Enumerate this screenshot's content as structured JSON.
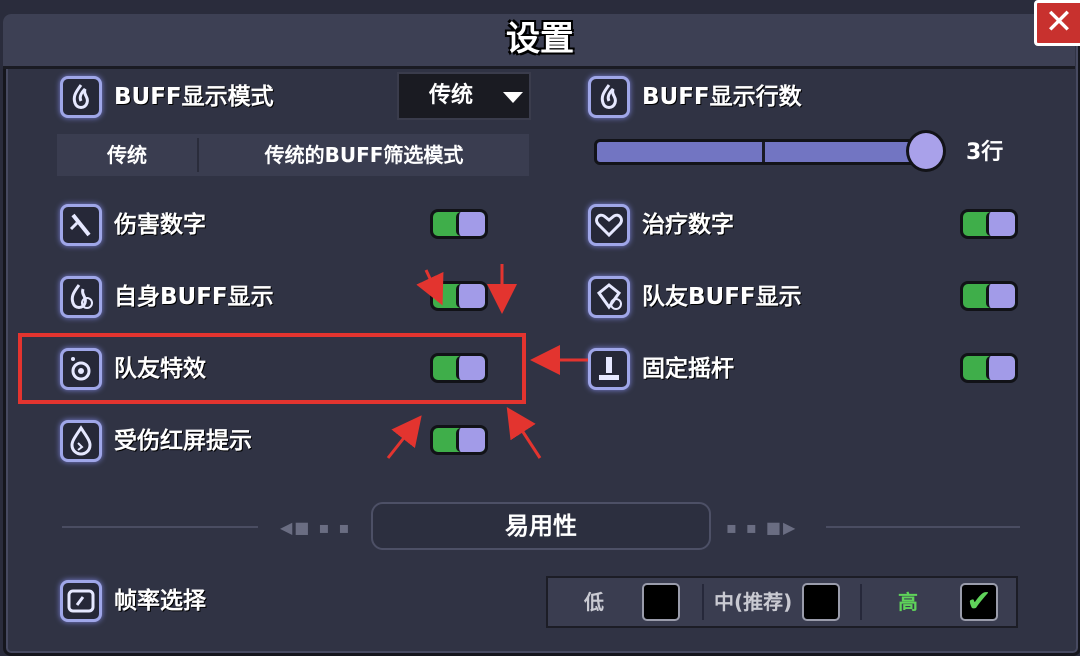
{
  "window": {
    "title": "设置",
    "close_icon": "✕"
  },
  "settings": {
    "buff_display_mode": {
      "label": "BUFF显示模式",
      "icon": "flame-icon",
      "value": "传统"
    },
    "buff_mode_desc": {
      "name": "传统",
      "desc": "传统的BUFF筛选模式"
    },
    "buff_rows": {
      "label": "BUFF显示行数",
      "icon": "flame-icon",
      "value_text": "3行",
      "fraction": 1.0
    },
    "damage_numbers": {
      "label": "伤害数字",
      "icon": "sword-icon",
      "on": true
    },
    "heal_numbers": {
      "label": "治疗数字",
      "icon": "heart-icon",
      "on": true
    },
    "self_buff": {
      "label": "自身BUFF显示",
      "icon": "flame-icon",
      "on": true
    },
    "ally_buff": {
      "label": "队友BUFF显示",
      "icon": "gem-icon",
      "on": true
    },
    "ally_effects": {
      "label": "队友特效",
      "icon": "target-icon",
      "on": true
    },
    "fixed_joystick": {
      "label": "固定摇杆",
      "icon": "joystick-icon",
      "on": true
    },
    "damage_flash": {
      "label": "受伤红屏提示",
      "icon": "drop-icon",
      "on": true
    }
  },
  "accessibility": {
    "title": "易用性"
  },
  "frame_rate": {
    "label": "帧率选择",
    "icon": "fps-icon",
    "options": [
      {
        "label": "低",
        "selected": false
      },
      {
        "label": "中(推荐)",
        "selected": false
      },
      {
        "label": "高",
        "selected": true
      }
    ],
    "check_glyph": "✔",
    "selected_color": "#5fd35a"
  },
  "colors": {
    "toggle_on": "#3fae4a",
    "knob": "#a29be8",
    "annotation": "#e3342f"
  }
}
